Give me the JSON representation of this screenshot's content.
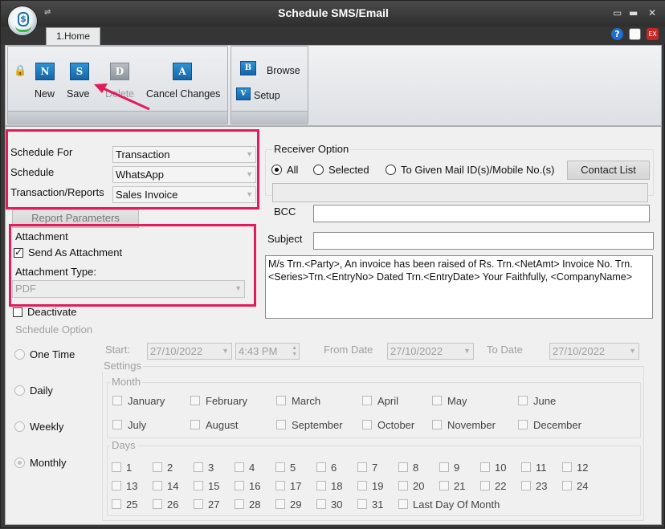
{
  "window": {
    "title": "Schedule SMS/Email",
    "qa_glyph": "⇌"
  },
  "tabs": [
    {
      "label": "1.Home"
    }
  ],
  "ribbon": {
    "new": {
      "label": "New",
      "glyph": "N"
    },
    "save": {
      "label": "Save",
      "glyph": "S"
    },
    "delete": {
      "label": "Delete",
      "glyph": "D"
    },
    "cancel": {
      "label": "Cancel Changes",
      "glyph": "A"
    },
    "browse": {
      "label": "Browse",
      "glyph": "B"
    },
    "setup": {
      "label": "Setup",
      "glyph": "V"
    }
  },
  "form": {
    "schedule_for": {
      "label": "Schedule For",
      "value": "Transaction"
    },
    "schedule": {
      "label": "Schedule",
      "value": "WhatsApp"
    },
    "transaction_reports": {
      "label": "Transaction/Reports",
      "value": "Sales Invoice"
    },
    "report_parameters": "Report Parameters",
    "attachment": {
      "heading": "Attachment",
      "send_as_attachment": "Send As Attachment",
      "send_as_attachment_checked": true,
      "type_label": "Attachment Type:",
      "type_value": "PDF"
    },
    "deactivate": {
      "label": "Deactivate",
      "checked": false
    }
  },
  "receiver": {
    "heading": "Receiver Option",
    "options": [
      {
        "label": "All",
        "selected": true
      },
      {
        "label": "Selected",
        "selected": false
      },
      {
        "label": "To Given Mail ID(s)/Mobile No.(s)",
        "selected": false
      }
    ],
    "contact_list": "Contact List",
    "bcc_label": "BCC",
    "subject_label": "Subject",
    "message": "M/s Trn.<Party>, An invoice has been raised of Rs. Trn.<NetAmt> Invoice No. Trn.<Series>Trn.<EntryNo> Dated Trn.<EntryDate> Your Faithfully, <CompanyName>"
  },
  "schedule_option": {
    "heading": "Schedule Option",
    "options": [
      {
        "label": "One Time",
        "selected": false
      },
      {
        "label": "Daily",
        "selected": false
      },
      {
        "label": "Weekly",
        "selected": false
      },
      {
        "label": "Monthly",
        "selected": true
      }
    ],
    "start_label": "Start:",
    "start_date": "27/10/2022",
    "start_time": "4:43 PM",
    "from_date_label": "From Date",
    "from_date": "27/10/2022",
    "to_date_label": "To Date",
    "to_date": "27/10/2022",
    "settings_label": "Settings",
    "month_label": "Month",
    "months": [
      "January",
      "February",
      "March",
      "April",
      "May",
      "June",
      "July",
      "August",
      "September",
      "October",
      "November",
      "December"
    ],
    "days_label": "Days",
    "days": [
      "1",
      "2",
      "3",
      "4",
      "5",
      "6",
      "7",
      "8",
      "9",
      "10",
      "11",
      "12",
      "13",
      "14",
      "15",
      "16",
      "17",
      "18",
      "19",
      "20",
      "21",
      "22",
      "23",
      "24",
      "25",
      "26",
      "27",
      "28",
      "29",
      "30",
      "31",
      "Last Day Of Month"
    ]
  },
  "colors": {
    "highlight": "#e31b5a",
    "ribbon_icon": "#1f7bc0"
  }
}
